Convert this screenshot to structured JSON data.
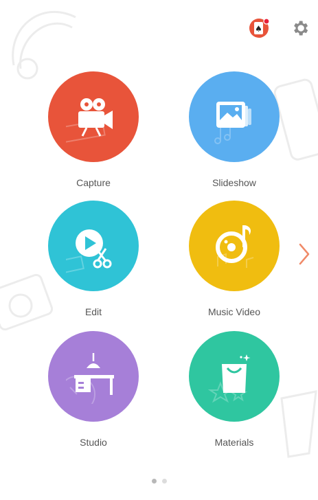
{
  "colors": {
    "capture": "#e8543a",
    "slideshow": "#5aaef0",
    "edit": "#2fc3d6",
    "music_video": "#f0bd10",
    "studio": "#a67fd8",
    "materials": "#2fc6a0",
    "label": "#555555",
    "arrow": "#f08a68",
    "dot_active": "#b8b8b8",
    "dot_inactive": "#dcdcdc"
  },
  "topbar": {
    "promo_icon": "cards-badge-icon",
    "settings_icon": "gear-icon"
  },
  "tiles": [
    {
      "key": "capture",
      "label": "Capture",
      "icon": "video-camera-icon"
    },
    {
      "key": "slideshow",
      "label": "Slideshow",
      "icon": "photo-stack-icon"
    },
    {
      "key": "edit",
      "label": "Edit",
      "icon": "play-scissors-icon"
    },
    {
      "key": "music_video",
      "label": "Music Video",
      "icon": "music-disc-icon"
    },
    {
      "key": "studio",
      "label": "Studio",
      "icon": "desk-lamp-icon"
    },
    {
      "key": "materials",
      "label": "Materials",
      "icon": "shopping-bag-icon"
    }
  ],
  "pager": {
    "pages": 2,
    "current": 1,
    "next_icon": "chevron-right-icon"
  }
}
